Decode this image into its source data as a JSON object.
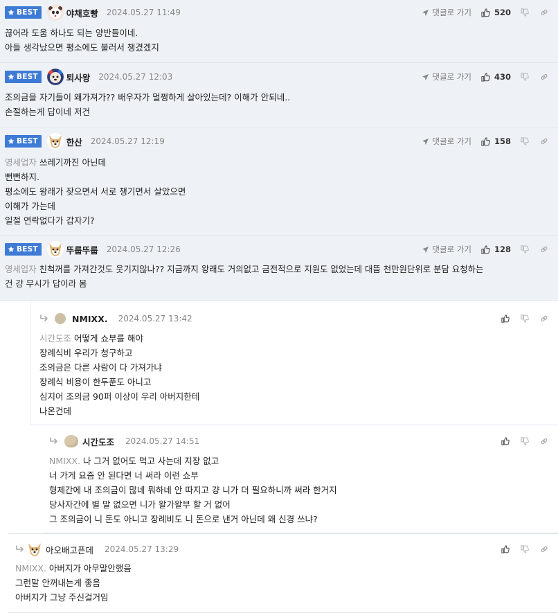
{
  "labels": {
    "best": "BEST",
    "goto": "댓글로 가기"
  },
  "colors": {
    "best_bg": "#eef2f7",
    "badge": "#3d7bd6",
    "mention": "#999999"
  },
  "icons": [
    "star-icon",
    "send-arrow-icon",
    "thumbs-up-icon",
    "thumbs-down-icon",
    "link-icon",
    "reply-arrow-icon",
    "avatar-dog-icon"
  ],
  "comments": [
    {
      "nick": "야채호빵",
      "date": "2024.05.27 11:49",
      "likes": "520",
      "mention": "",
      "lines": [
        "끊어라 도움 하나도 되는 양반들이네.",
        "아들 생각났으면 평소에도 불러서 챙겼겠지"
      ]
    },
    {
      "nick": "퇴사왕",
      "date": "2024.05.27 12:03",
      "likes": "430",
      "mention": "",
      "lines": [
        "조의금을 자기들이 왜가져가?? 배우자가 멀쩡하게 살아있는데? 이해가 안되네..",
        "손절하는게 답이네 저건"
      ]
    },
    {
      "nick": "한산",
      "date": "2024.05.27 12:19",
      "likes": "158",
      "mention": "영세업자",
      "lines": [
        "쓰레기까진 아닌데",
        "뻔뻔하지.",
        "평소에도 왕래가 잦으면서 서로 챙기면서 살았으면",
        "이해가 가는데",
        "일절 연락없다가 갑자기?"
      ]
    },
    {
      "nick": "뚜룹뚜룹",
      "date": "2024.05.27 12:26",
      "likes": "128",
      "mention": "영세업자",
      "lines": [
        "친척꺼를 가져간것도 웃기지않나?? 지금까지 왕래도 거의없고 금전적으로 지원도 없었는데 대뜸 천만원단위로 분담 요청하는",
        "건 걍 무시가 답이라 봄"
      ]
    }
  ],
  "replies": [
    {
      "nick": "NMIXX.",
      "date": "2024.05.27 13:42",
      "mention": "시간도조",
      "lines": [
        "어떻게 쇼부를 해야",
        "장례식비 우리가 청구하고",
        "조의금은 다른 사람이 다 가져가냐",
        "장례식 비용이 한두푼도 아니고",
        "심지어 조의금 90퍼 이상이 우리 아버지한테",
        "나온건데"
      ]
    },
    {
      "nick": "시간도조",
      "date": "2024.05.27 14:51",
      "mention": "NMIXX.",
      "lines": [
        "나 그거 없어도 먹고 사는데 지장 없고",
        "너 가게 요즘 안 된다면 너 써라 이런 쇼부",
        "형제간에 내 조의금이 많네 뭐하네 안 따지고 걍 니가 더 필요하니까 써라 한거지",
        "당사자간에 별 말 없으면 니가 왈가왈부 할 거 없어",
        "그 조의금이 니 돈도 아니고 장례비도 니 돈으로 낸거 아닌데 왜 신경 쓰냐?"
      ]
    },
    {
      "nick": "아오배고픈데",
      "date": "2024.05.27 13:29",
      "mention": "NMIXX.",
      "lines": [
        "아버지가 아무말안했음",
        "그런말 안꺼내는게 좋음",
        "아버지가 그냥 주신걸거임"
      ]
    }
  ]
}
